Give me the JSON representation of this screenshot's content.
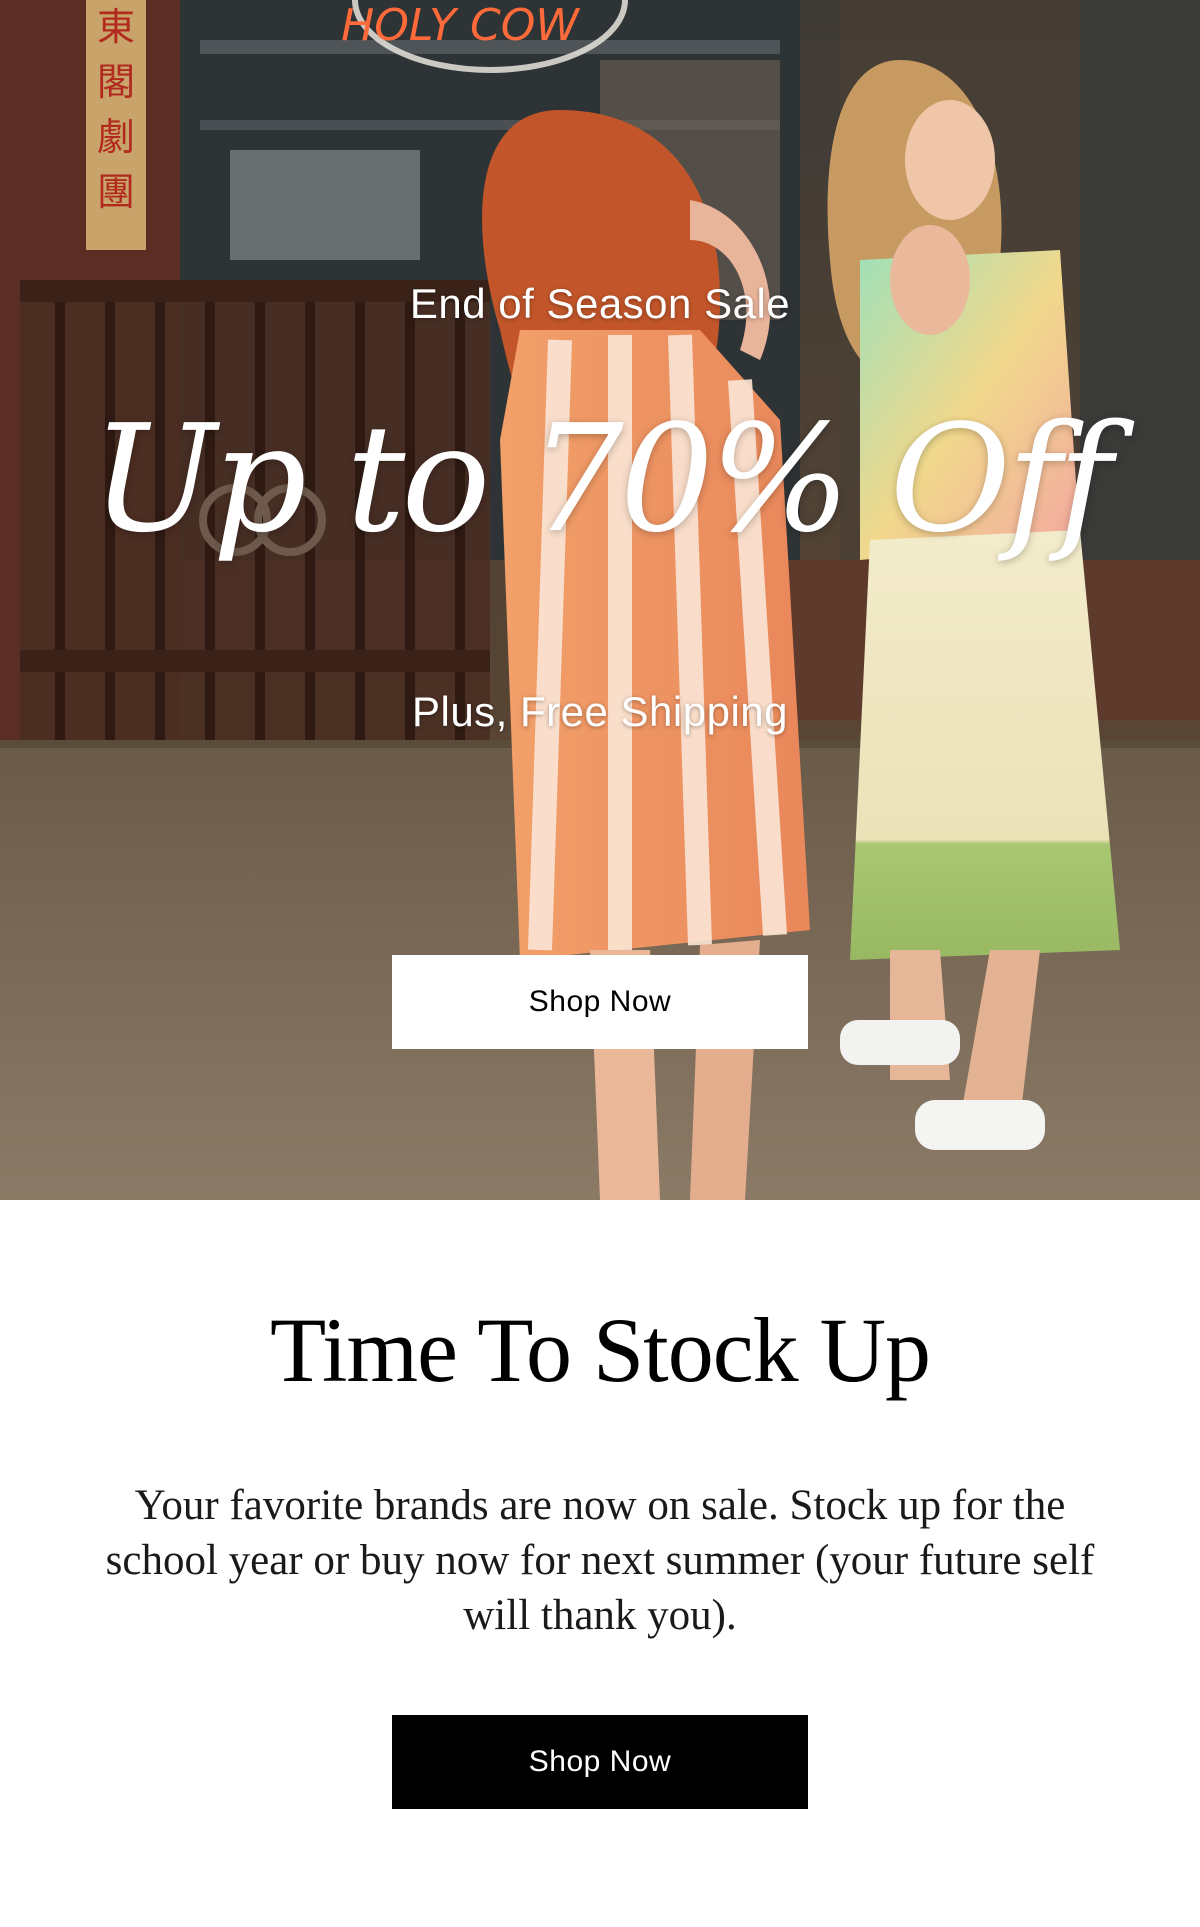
{
  "hero": {
    "background": "street-photo",
    "sign_text": "HOLY COW",
    "sign_chars": "東閣劇團",
    "eyebrow": "End of Season Sale",
    "headline": "Up to 70% Off",
    "subline": "Plus, Free Shipping",
    "cta_label": "Shop Now"
  },
  "section": {
    "title": "Time To Stock Up",
    "body": "Your favorite brands are now on sale. Stock up for the school year or buy now for next summer (your future self will thank you).",
    "cta_label": "Shop Now"
  },
  "colors": {
    "hero_cta_bg": "#ffffff",
    "hero_cta_text": "#000000",
    "section_cta_bg": "#000000",
    "section_cta_text": "#ffffff",
    "neon_sign": "#ff6a3a"
  }
}
